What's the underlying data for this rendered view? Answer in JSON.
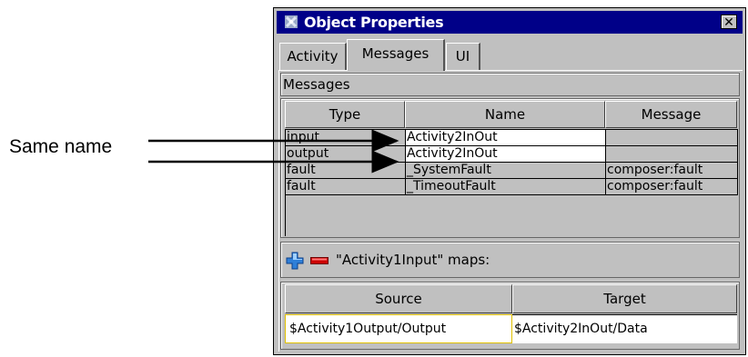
{
  "annotation": {
    "label": "Same name"
  },
  "window": {
    "title": "Object Properties",
    "close_label": "✕",
    "tabs": [
      {
        "label": "Activity",
        "active": false
      },
      {
        "label": "Messages",
        "active": true
      },
      {
        "label": "UI",
        "active": false
      }
    ]
  },
  "messages": {
    "section_label": "Messages",
    "columns": [
      "Type",
      "Name",
      "Message"
    ],
    "rows": [
      {
        "type": "input",
        "name": "Activity2InOut",
        "message": ""
      },
      {
        "type": "output",
        "name": "Activity2InOut",
        "message": ""
      },
      {
        "type": "fault",
        "name": "_SystemFault",
        "message": "composer:fault"
      },
      {
        "type": "fault",
        "name": "_TimeoutFault",
        "message": "composer:fault"
      }
    ]
  },
  "mapping": {
    "add_icon": "plus-icon",
    "remove_icon": "minus-icon",
    "label": "\"Activity1Input\" maps:",
    "columns": [
      "Source",
      "Target"
    ],
    "rows": [
      {
        "source": "$Activity1Output/Output",
        "target": "$Activity2InOut/Data"
      }
    ]
  },
  "colors": {
    "titlebar": "#000088",
    "panel": "#c0c0c0",
    "add": "#2f7fd8",
    "remove": "#cc0000",
    "selection_outline": "#e0c000"
  }
}
